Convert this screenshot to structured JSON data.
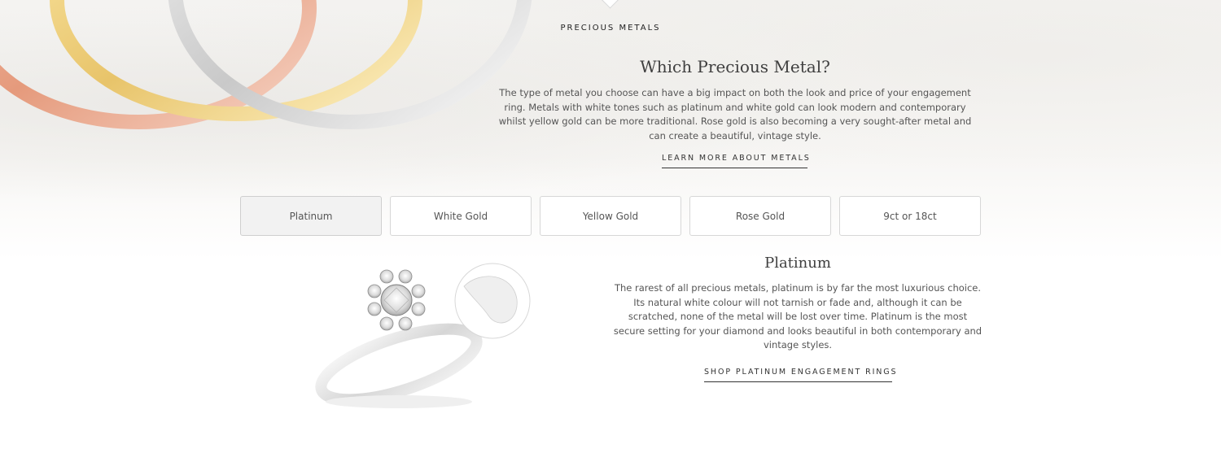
{
  "header": {
    "eyebrow": "PRECIOUS METALS",
    "title": "Which Precious Metal?",
    "body": "The type of metal you choose can have a big impact on both the look and price of your engagement ring. Metals with white tones such as platinum and white gold can look modern and contemporary whilst yellow gold can be more traditional. Rose gold is also becoming a very sought-after metal and can create a beautiful, vintage style.",
    "link_label": "LEARN MORE ABOUT METALS"
  },
  "tabs": [
    {
      "label": "Platinum",
      "active": true
    },
    {
      "label": "White Gold",
      "active": false
    },
    {
      "label": "Yellow Gold",
      "active": false
    },
    {
      "label": "Rose Gold",
      "active": false
    },
    {
      "label": "9ct or 18ct",
      "active": false
    }
  ],
  "detail": {
    "title": "Platinum",
    "body": "The rarest of all precious metals, platinum is by far the most luxurious choice. Its natural white colour will not tarnish or fade and, although it can be scratched, none of the metal will be lost over time. Platinum is the most secure setting for your diamond and looks beautiful in both contemporary and vintage styles.",
    "link_label": "SHOP PLATINUM ENGAGEMENT RINGS"
  },
  "colors": {
    "rose_gold": "#e7a58c",
    "yellow_gold": "#f1d37e",
    "platinum": "#d9d9d9",
    "tab_active_bg": "#f2f2f2",
    "text": "#555555"
  }
}
